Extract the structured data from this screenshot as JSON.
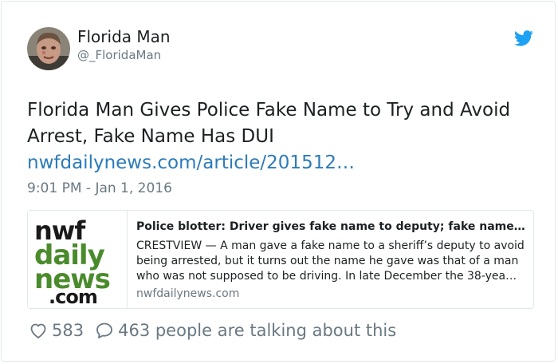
{
  "author": {
    "display_name": "Florida Man",
    "handle": "@_FloridaMan"
  },
  "tweet": {
    "text": "Florida Man Gives Police Fake Name to Try and Avoid Arrest, Fake Name Has DUI",
    "link_text": "nwfdailynews.com/article/201512…",
    "timestamp": "9:01 PM - Jan 1, 2016"
  },
  "link_card": {
    "logo": {
      "line1": "nwf",
      "line2": "daily",
      "line3": "news",
      "line4": ".com"
    },
    "title": "Police blotter: Driver gives fake name to deputy; fake name…",
    "description": "CRESTVIEW — A man gave a fake name to a sheriff’s deputy to avoid being arrested, but it turns out the name he gave was that of a man who was not supposed to be driving. In late December the 38-yea…",
    "domain": "nwfdailynews.com"
  },
  "footer": {
    "likes": "583",
    "replies_text": "463 people are talking about this"
  },
  "colors": {
    "link": "#2b7bb9",
    "twitter_blue": "#1da1f2",
    "muted": "#697882",
    "logo_green": "#4a8b2c"
  },
  "icons": [
    "twitter-bird-icon",
    "heart-icon",
    "speech-bubble-icon"
  ]
}
